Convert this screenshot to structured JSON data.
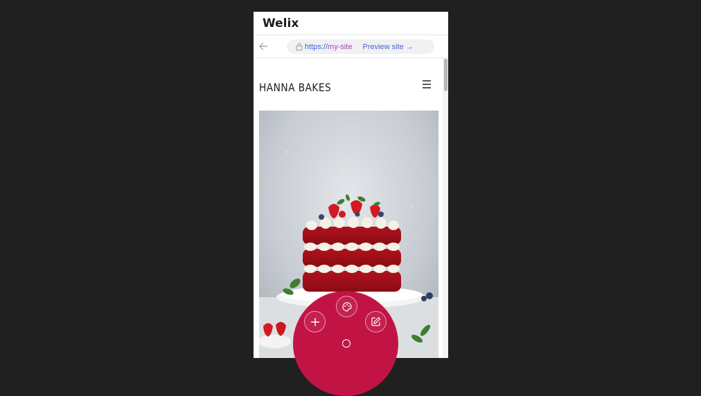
{
  "app": {
    "title": "Welix"
  },
  "browser": {
    "url_protocol": "https://",
    "url_host": "my-site",
    "preview_label": "Preview site →"
  },
  "site": {
    "brand": "HANNA BAKES"
  },
  "icons": {
    "back": "arrow-left-icon",
    "lock": "lock-icon",
    "menu": "hamburger-menu-icon",
    "add": "plus-icon",
    "design": "palette-icon",
    "edit": "edit-icon",
    "home": "circle-icon"
  },
  "colors": {
    "accent": "#c21444",
    "link": "#4b62d8",
    "host": "#b83dc0"
  }
}
